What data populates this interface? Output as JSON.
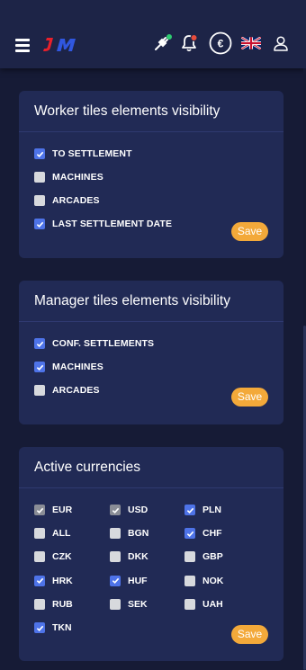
{
  "header": {
    "logo_text": "JM"
  },
  "cards": [
    {
      "title": "Worker tiles elements visibility",
      "options": [
        {
          "label": "TO SETTLEMENT",
          "checked": true
        },
        {
          "label": "MACHINES",
          "checked": false
        },
        {
          "label": "ARCADES",
          "checked": false
        },
        {
          "label": "LAST SETTLEMENT DATE",
          "checked": true
        }
      ],
      "save_label": "Save"
    },
    {
      "title": "Manager tiles elements visibility",
      "options": [
        {
          "label": "CONF. SETTLEMENTS",
          "checked": true
        },
        {
          "label": "MACHINES",
          "checked": true
        },
        {
          "label": "ARCADES",
          "checked": false
        }
      ],
      "save_label": "Save"
    },
    {
      "title": "Active currencies",
      "currencies": [
        {
          "code": "EUR",
          "state": "disabled"
        },
        {
          "code": "USD",
          "state": "disabled"
        },
        {
          "code": "PLN",
          "state": "checked"
        },
        {
          "code": "ALL",
          "state": "unchecked"
        },
        {
          "code": "BGN",
          "state": "unchecked"
        },
        {
          "code": "CHF",
          "state": "checked"
        },
        {
          "code": "CZK",
          "state": "unchecked"
        },
        {
          "code": "DKK",
          "state": "unchecked"
        },
        {
          "code": "GBP",
          "state": "unchecked"
        },
        {
          "code": "HRK",
          "state": "checked"
        },
        {
          "code": "HUF",
          "state": "checked"
        },
        {
          "code": "NOK",
          "state": "unchecked"
        },
        {
          "code": "RUB",
          "state": "unchecked"
        },
        {
          "code": "SEK",
          "state": "unchecked"
        },
        {
          "code": "UAH",
          "state": "unchecked"
        },
        {
          "code": "TKN",
          "state": "checked"
        }
      ],
      "save_label": "Save"
    }
  ],
  "colors": {
    "accent": "#4e73e8",
    "save": "#f3a93a",
    "card": "#212a55",
    "background": "#161b36",
    "status_dot": "#2ecc71",
    "notification_dot": "#e74c3c"
  }
}
